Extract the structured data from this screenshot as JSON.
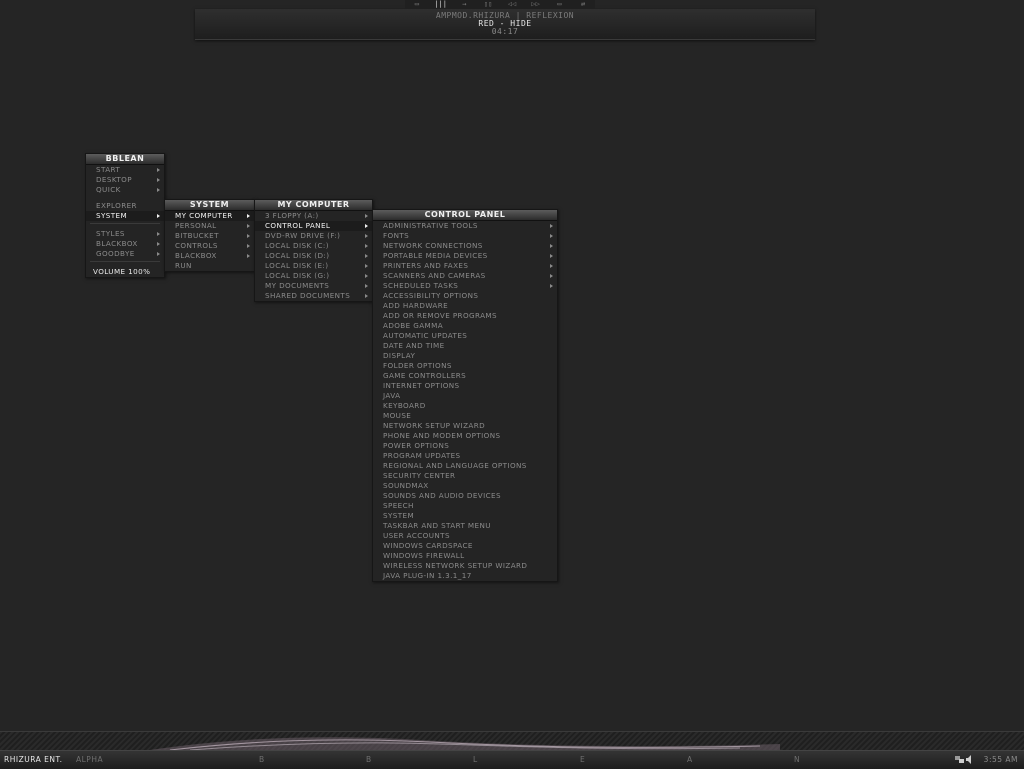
{
  "top_bar": {
    "line1": "AMPMOD.RHIZURA | REFLEXION",
    "line2": "RED - HIDE",
    "line3": "04:17",
    "controls": [
      "▭",
      "|||",
      "→",
      "▯▯",
      "◁◁",
      "▷▷",
      "▭",
      "⇄"
    ]
  },
  "menus": {
    "bblean": {
      "title": "BBLEAN",
      "items": [
        {
          "label": "START",
          "arrow": true
        },
        {
          "label": "DESKTOP",
          "arrow": true
        },
        {
          "label": "QUICK",
          "arrow": true
        },
        {
          "sep": true
        },
        {
          "label": "EXPLORER",
          "arrow": false
        },
        {
          "label": "SYSTEM",
          "arrow": true,
          "hl": true
        },
        {
          "sepline": true
        },
        {
          "label": "STYLES",
          "arrow": true
        },
        {
          "label": "BLACKBOX",
          "arrow": true
        },
        {
          "label": "GOODBYE",
          "arrow": true
        },
        {
          "sepline": true
        },
        {
          "label": "VOLUME 100%",
          "arrow": false,
          "vol": true
        }
      ]
    },
    "system": {
      "title": "SYSTEM",
      "items": [
        {
          "label": "MY COMPUTER",
          "arrow": true,
          "hl": true
        },
        {
          "label": "PERSONAL",
          "arrow": true
        },
        {
          "label": "BITBUCKET",
          "arrow": true
        },
        {
          "label": "CONTROLS",
          "arrow": true
        },
        {
          "label": "BLACKBOX",
          "arrow": true
        },
        {
          "label": "RUN",
          "arrow": false
        }
      ]
    },
    "my_computer": {
      "title": "MY COMPUTER",
      "items": [
        {
          "label": "3 FLOPPY (A:)",
          "arrow": true
        },
        {
          "label": "CONTROL PANEL",
          "arrow": true,
          "hl": true
        },
        {
          "label": "DVD-RW DRIVE (F:)",
          "arrow": true
        },
        {
          "label": "LOCAL DISK (C:)",
          "arrow": true
        },
        {
          "label": "LOCAL DISK (D:)",
          "arrow": true
        },
        {
          "label": "LOCAL DISK (E:)",
          "arrow": true
        },
        {
          "label": "LOCAL DISK (G:)",
          "arrow": true
        },
        {
          "label": "MY DOCUMENTS",
          "arrow": true
        },
        {
          "label": "SHARED DOCUMENTS",
          "arrow": true
        }
      ]
    },
    "control_panel": {
      "title": "CONTROL PANEL",
      "items": [
        {
          "label": "ADMINISTRATIVE TOOLS",
          "arrow": true
        },
        {
          "label": "FONTS",
          "arrow": true
        },
        {
          "label": "NETWORK CONNECTIONS",
          "arrow": true
        },
        {
          "label": "PORTABLE MEDIA DEVICES",
          "arrow": true
        },
        {
          "label": "PRINTERS AND FAXES",
          "arrow": true
        },
        {
          "label": "SCANNERS AND CAMERAS",
          "arrow": true
        },
        {
          "label": "SCHEDULED TASKS",
          "arrow": true
        },
        {
          "label": "ACCESSIBILITY OPTIONS",
          "arrow": false
        },
        {
          "label": "ADD HARDWARE",
          "arrow": false
        },
        {
          "label": "ADD OR REMOVE PROGRAMS",
          "arrow": false
        },
        {
          "label": "ADOBE GAMMA",
          "arrow": false
        },
        {
          "label": "AUTOMATIC UPDATES",
          "arrow": false
        },
        {
          "label": "DATE AND TIME",
          "arrow": false
        },
        {
          "label": "DISPLAY",
          "arrow": false
        },
        {
          "label": "FOLDER OPTIONS",
          "arrow": false
        },
        {
          "label": "GAME CONTROLLERS",
          "arrow": false
        },
        {
          "label": "INTERNET OPTIONS",
          "arrow": false
        },
        {
          "label": "JAVA",
          "arrow": false
        },
        {
          "label": "KEYBOARD",
          "arrow": false
        },
        {
          "label": "MOUSE",
          "arrow": false
        },
        {
          "label": "NETWORK SETUP WIZARD",
          "arrow": false
        },
        {
          "label": "PHONE AND MODEM OPTIONS",
          "arrow": false
        },
        {
          "label": "POWER OPTIONS",
          "arrow": false
        },
        {
          "label": "PROGRAM UPDATES",
          "arrow": false
        },
        {
          "label": "REGIONAL AND LANGUAGE OPTIONS",
          "arrow": false
        },
        {
          "label": "SECURITY CENTER",
          "arrow": false
        },
        {
          "label": "SOUNDMAX",
          "arrow": false
        },
        {
          "label": "SOUNDS AND AUDIO DEVICES",
          "arrow": false
        },
        {
          "label": "SPEECH",
          "arrow": false
        },
        {
          "label": "SYSTEM",
          "arrow": false
        },
        {
          "label": "TASKBAR AND START MENU",
          "arrow": false
        },
        {
          "label": "USER ACCOUNTS",
          "arrow": false
        },
        {
          "label": "WINDOWS CARDSPACE",
          "arrow": false
        },
        {
          "label": "WINDOWS FIREWALL",
          "arrow": false
        },
        {
          "label": "WIRELESS NETWORK SETUP WIZARD",
          "arrow": false
        },
        {
          "label": "JAVA PLUG-IN 1.3.1_17",
          "arrow": false
        }
      ]
    }
  },
  "taskbar": {
    "left_label": "RHIZURA ENT.",
    "workspace": "ALPHA",
    "letters": [
      "B",
      "B",
      "L",
      "E",
      "A",
      "N"
    ],
    "clock": "3:55 AM",
    "tray_icons": [
      "network-icon",
      "speaker-icon"
    ]
  },
  "colors": {
    "background": "#252525",
    "menu_bg": "#242424",
    "text": "#8a8a8a",
    "highlight_text": "#f2f2f2"
  }
}
